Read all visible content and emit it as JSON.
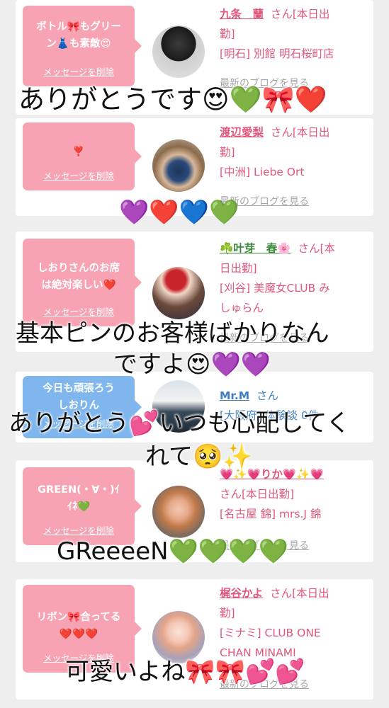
{
  "messages": [
    {
      "bubble_text": [
        "ボトル🎀もグリー",
        "ン👗も素敵😍"
      ],
      "delete_label": "メッセージを削除",
      "name": "九条　蘭",
      "name_suffix": "さん[本日出",
      "name_suffix2": "勤]",
      "store": "[明石] 別館 明石桜町店",
      "store2": "",
      "blog_link": "最新のブログを見る"
    },
    {
      "bubble_text": [
        "❣️"
      ],
      "delete_label": "メッセージを削除",
      "name": "渡辺愛梨",
      "name_suffix": "さん[本日出",
      "name_suffix2": "勤]",
      "store": "[中洲] Liebe Ort",
      "store2": "",
      "blog_link": "最新のブログを見る"
    },
    {
      "bubble_text": [
        "しおりさんのお席",
        "は絶対楽しい❤️"
      ],
      "delete_label": "メッセージを削除",
      "name": "☘️叶芽　春🌸",
      "name_suffix": "さん[本",
      "name_suffix2": "日出勤]",
      "store": "[刈谷] 美魔女CLUB み",
      "store2": "しゅらん",
      "blog_link": "最新のブログを見る"
    },
    {
      "bubble_text": [
        "今日も頑張ろう",
        "しおりん"
      ],
      "delete_label": "メッセージを削除",
      "name": "Mr.M",
      "name_suffix": "さん",
      "name_suffix2": "",
      "store": "[大阪府] 体験談 0件",
      "store2": "",
      "blog_link": ""
    },
    {
      "bubble_text": [
        "GREEN(・∀・)ｲ",
        "ｲﾈ💚"
      ],
      "delete_label": "メッセージを削除",
      "name": "💗✨💗りか💗✨💗",
      "name_suffix": "",
      "name_suffix2": "さん[本日出勤]",
      "store": "[名古屋 錦] mrs.J 錦",
      "store2": "",
      "blog_link": "最新のブログを見る"
    },
    {
      "bubble_text": [
        "リボン🎀合ってる",
        "❤️❤️❤️"
      ],
      "delete_label": "メッセージを削除",
      "name": "梶谷かよ",
      "name_suffix": "さん[本日出",
      "name_suffix2": "勤]",
      "store": "[ミナミ] CLUB ONE",
      "store2": "CHAN MINAMI",
      "blog_link": "最新のブログを見る"
    }
  ],
  "captions": {
    "c1": "ありがとうです😍💚🎀❤️",
    "c2": "💜❤️💙💚",
    "c3a": "基本ピンのお客様ばかりなん",
    "c3b": "ですよ😍💜💜",
    "c4a": "ありがとう💕いつも心配してく",
    "c4b": "れて🥺✨",
    "c5": "GReeeeN💚💚💚💚",
    "c6": "可愛いよね🎀🎀💕💕"
  },
  "colors": {
    "bubble_pink": "#f7a3b3",
    "bubble_blue": "#7fb6ee",
    "name_pink": "#e0587a",
    "name_blue": "#3f7fc2",
    "background": "#eeeeee"
  }
}
